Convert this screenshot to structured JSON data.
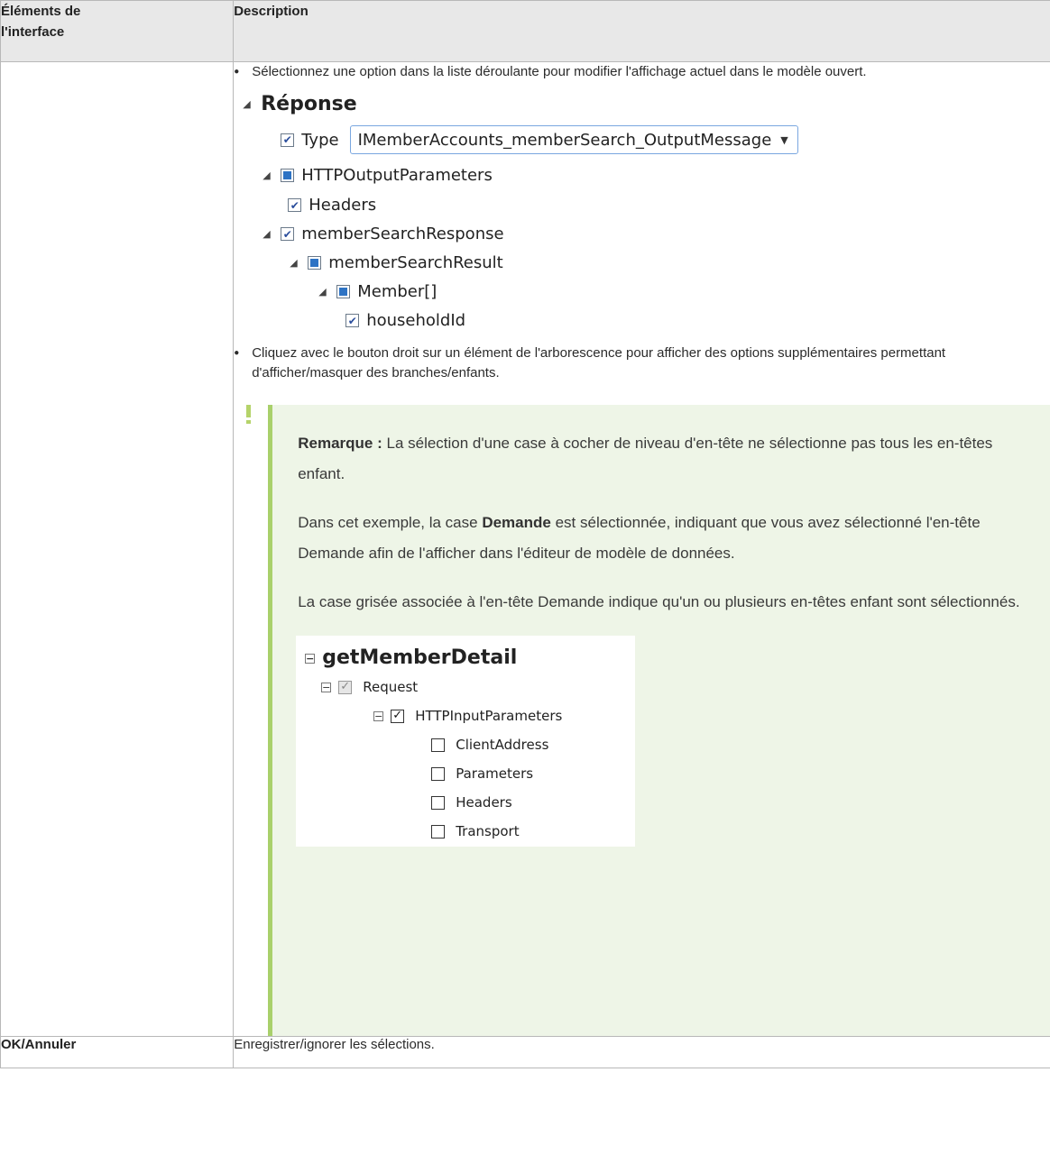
{
  "table": {
    "header": {
      "col1_line1": "Éléments de",
      "col1_line2": "l'interface",
      "col2": "Description"
    },
    "row1": {
      "ui_element": "",
      "bullets": [
        "Sélectionnez une option dans la liste déroulante pour modifier l'affichage actuel dans le modèle ouvert.",
        "Cliquez avec le bouton droit sur un élément de l'arborescence pour afficher des options supplémentaires permettant d'afficher/masquer des branches/enfants."
      ],
      "tree1": {
        "root": "Réponse",
        "type_label": "Type",
        "type_value": "IMemberAccounts_memberSearch_OutputMessage",
        "nodes": [
          "HTTPOutputParameters",
          "Headers",
          "memberSearchResponse",
          "memberSearchResult",
          "Member[]",
          "householdId"
        ]
      },
      "note": {
        "label": "Remarque :",
        "text1": "La sélection d'une case à cocher de niveau d'en-tête ne sélectionne pas tous les en-têtes enfant.",
        "p2_before": "Dans cet exemple, la case ",
        "p2_bold": "Demande",
        "p2_after": " est sélectionnée, indiquant que vous avez sélectionné l'en-tête Demande afin de l'afficher dans l'éditeur de modèle de données.",
        "p3": "La case grisée associée à l'en-tête Demande indique qu'un ou plusieurs en-têtes enfant sont sélectionnés."
      },
      "tree2": {
        "root": "getMemberDetail",
        "request": "Request",
        "http": "HTTPInputParameters",
        "children": [
          "ClientAddress",
          "Parameters",
          "Headers",
          "Transport"
        ]
      }
    },
    "row2": {
      "ui_element": "OK/Annuler",
      "description": "Enregistrer/ignorer les sélections."
    }
  },
  "icons": {
    "expanded": "triangle-expanded-icon",
    "collapse": "minus-box-icon",
    "check": "checkbox-checked-icon",
    "partial": "checkbox-partial-icon",
    "note": "exclamation-note-icon",
    "dropdown": "chevron-down-icon"
  },
  "colors": {
    "header_bg": "#e8e8e8",
    "note_bg": "#eef5e7",
    "note_border": "#a9d06b",
    "select_border": "#7aa7e0"
  }
}
